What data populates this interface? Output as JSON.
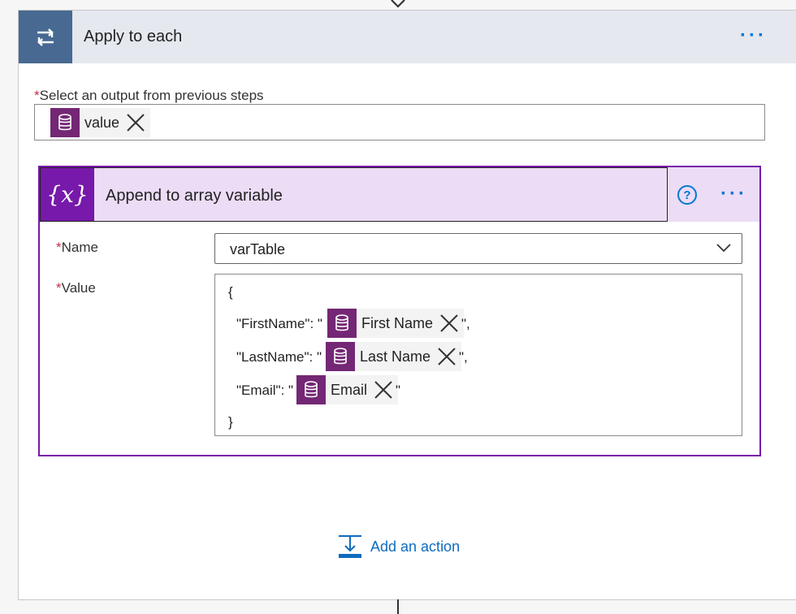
{
  "outer": {
    "title": "Apply to each",
    "select_label": "Select an output from previous steps",
    "token_value": "value"
  },
  "inner": {
    "title": "Append to array variable",
    "name_label": "Name",
    "value_label": "Value",
    "name_value": "varTable",
    "value_lines": {
      "open": "{",
      "first_key": "\"FirstName\": \"",
      "first_token": "First Name",
      "first_tail": "\",",
      "last_key": "\"LastName\": \"",
      "last_token": "Last Name",
      "last_tail": "\",",
      "email_key": "\"Email\": \"",
      "email_token": "Email",
      "email_tail": "\"",
      "close": "}"
    }
  },
  "footer": {
    "add_action_label": "Add an action"
  },
  "colors": {
    "outer_icon_bg": "#486991",
    "inner_icon_bg": "#7719aa",
    "token_icon_bg": "#742774",
    "link": "#0f6cbd"
  }
}
